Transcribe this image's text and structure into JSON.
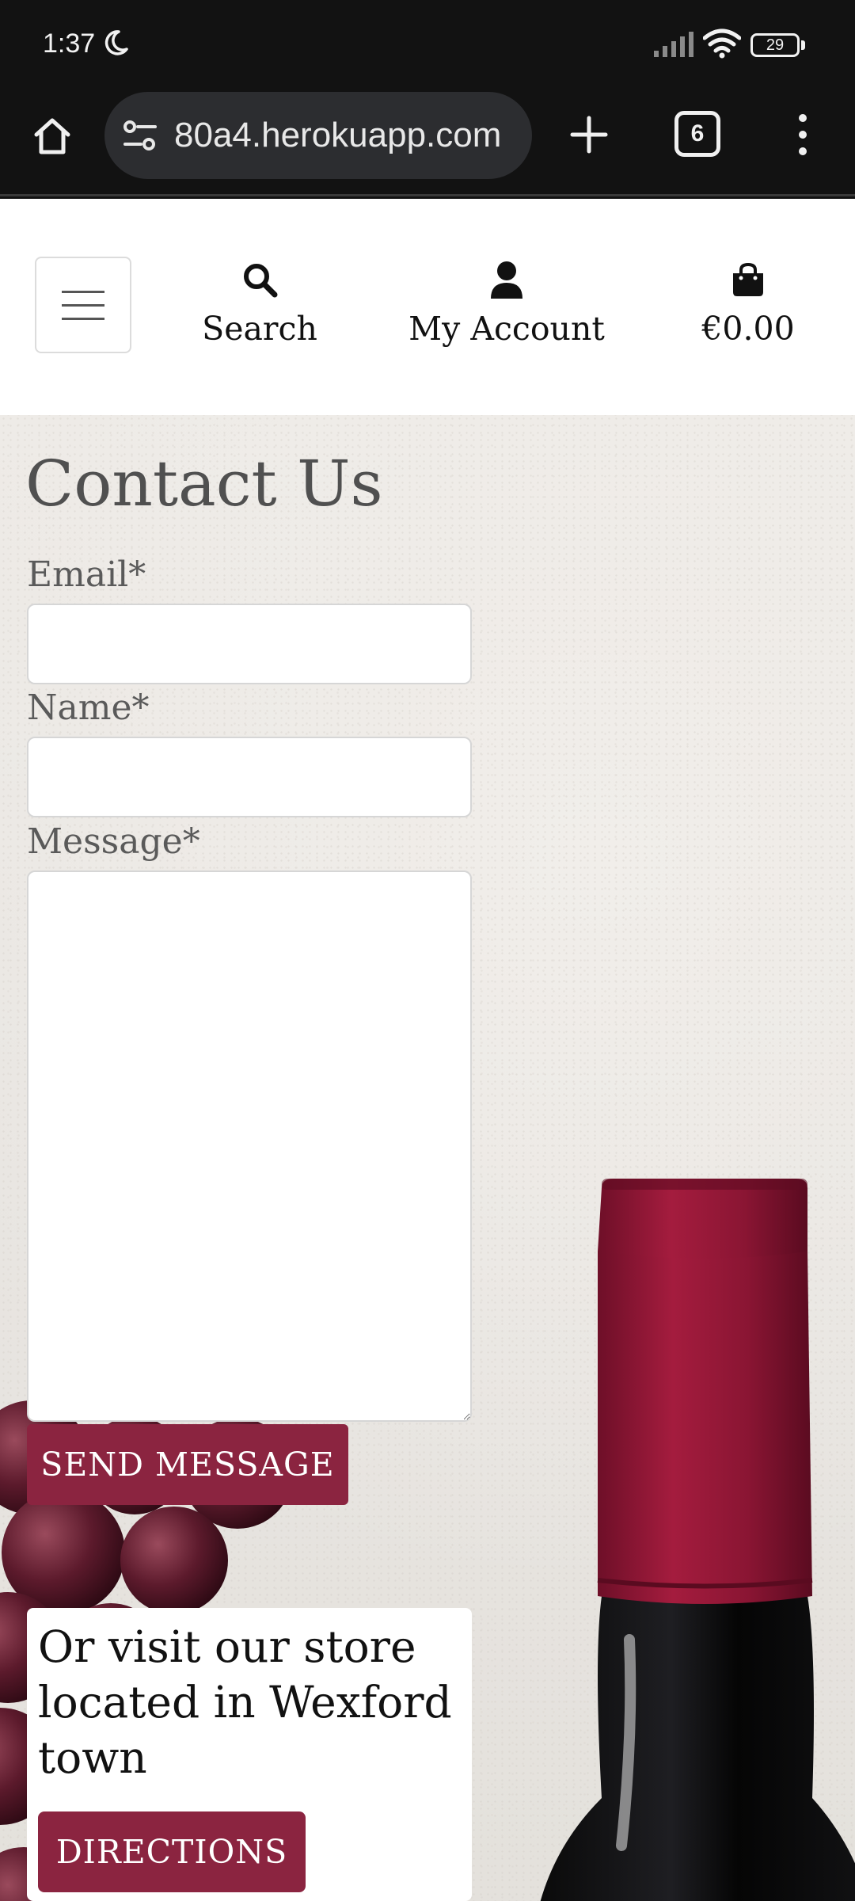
{
  "status_bar": {
    "time": "1:37",
    "battery": "29"
  },
  "browser": {
    "url": "80a4.herokuapp.com",
    "tab_count": "6"
  },
  "header": {
    "nav": {
      "search_label": "Search",
      "account_label": "My Account",
      "bag_total": "€0.00"
    }
  },
  "contact": {
    "title": "Contact Us",
    "email_label": "Email*",
    "email_value": "",
    "name_label": "Name*",
    "name_value": "",
    "message_label": "Message*",
    "message_value": "",
    "send_label": "SEND MESSAGE"
  },
  "store": {
    "visit_text": "Or visit our store located in Wexford town",
    "directions_label": "DIRECTIONS"
  },
  "colors": {
    "brand": "#8b2440",
    "status_bar_bg": "#121212",
    "url_pill_bg": "#2c2d30"
  },
  "icons": {
    "home": "home-icon",
    "tune": "tune-icon",
    "plus": "plus-icon",
    "tabs": "tabs-icon",
    "menu": "more-vert-icon",
    "search": "search-icon",
    "account": "user-icon",
    "bag": "shopping-bag-icon",
    "hamburger": "hamburger-menu-icon"
  }
}
